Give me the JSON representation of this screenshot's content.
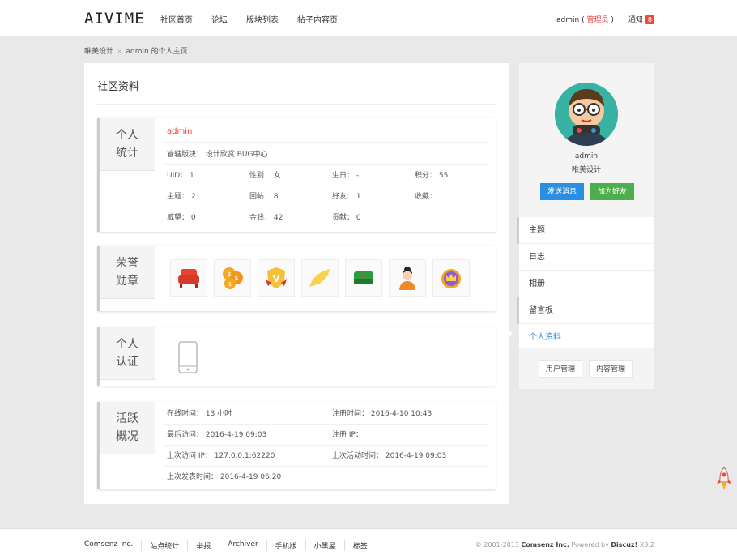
{
  "header": {
    "logo": "AIVIME",
    "nav": [
      "社区首页",
      "论坛",
      "版块列表",
      "帖子内容页"
    ],
    "user_prefix": "admin (",
    "user_role": "管理员",
    "user_suffix": ")",
    "notice_label": "通知",
    "notice_count": "8"
  },
  "breadcrumb": {
    "home": "唯美设计",
    "sep": "»",
    "current": "admin 的个人主页"
  },
  "main": {
    "title": "社区资料",
    "stats": {
      "label_l1": "个人",
      "label_l2": "统计",
      "username": "admin",
      "managed": "管辖版块：  设计欣赏   BUG中心",
      "uid": "UID：  1",
      "gender": "性别：  女",
      "birthday": "生日：  -",
      "points": "积分：  55",
      "threads": "主题：  2",
      "replies": "回帖：  8",
      "friends": "好友：  1",
      "favorites": "收藏：",
      "prestige": "威望：  0",
      "money": "金钱：  42",
      "contrib": "贡献：  0"
    },
    "medals": {
      "label_l1": "荣誉",
      "label_l2": "勋章"
    },
    "verify": {
      "label_l1": "个人",
      "label_l2": "认证"
    },
    "activity": {
      "label_l1": "活跃",
      "label_l2": "概况",
      "online": "在线时间：  13 小时",
      "register_time": "注册时间：  2016-4-10 10:43",
      "last_visit": "最后访问：  2016-4-19 09:03",
      "register_ip": "注册 IP：",
      "last_ip": "上次访问 IP：  127.0.0.1:62220",
      "last_active": "上次活动时间：  2016-4-19 09:03",
      "last_post": "上次发表时间：  2016-4-19 06:20"
    }
  },
  "sidebar": {
    "name": "admin",
    "group": "唯美设计",
    "send_msg": "发送消息",
    "add_friend": "加为好友",
    "menu": [
      "主题",
      "日志",
      "相册",
      "留言板",
      "个人资料"
    ],
    "user_manage": "用户管理",
    "content_manage": "内容管理"
  },
  "footer": {
    "links": [
      "Comsenz Inc.",
      "站点统计",
      "举报",
      "Archiver",
      "手机版",
      "小黑屋",
      "标签"
    ],
    "copy_prefix": "© 2001-2013",
    "copy_company": "Comsenz Inc.",
    "copy_powered": "Powered by",
    "copy_product": "Discuz!",
    "copy_version": "X3.2"
  },
  "colors": {
    "accent_blue": "#2a8fe3",
    "accent_green": "#4cae4c",
    "accent_red": "#e33333"
  }
}
